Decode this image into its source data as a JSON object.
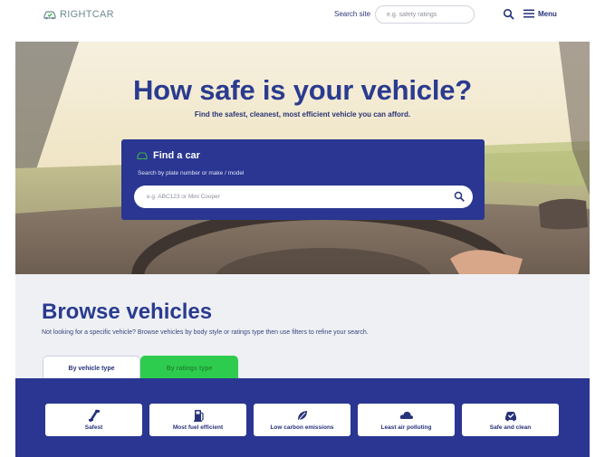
{
  "header": {
    "logo_text": "RIGHTCAR",
    "search_label": "Search site",
    "search_placeholder": "e.g. safety ratings",
    "menu_label": "Menu"
  },
  "hero": {
    "title": "How safe is your vehicle?",
    "subtitle": "Find the safest, cleanest, most efficient vehicle you can afford.",
    "find_card": {
      "title": "Find a car",
      "hint": "Search by plate number or make / model",
      "input_placeholder": "e.g. ABC123 or Mini Cooper"
    }
  },
  "browse": {
    "title": "Browse vehicles",
    "description": "Not looking for a specific vehicle? Browse vehicles by body style or ratings type then use filters to refine your search.",
    "tabs": [
      {
        "label": "By vehicle type"
      },
      {
        "label": "By ratings type"
      }
    ],
    "categories": [
      {
        "label": "Safest",
        "icon": "seatbelt-icon"
      },
      {
        "label": "Most fuel efficient",
        "icon": "fuel-pump-icon"
      },
      {
        "label": "Low carbon emissions",
        "icon": "leaf-icon"
      },
      {
        "label": "Least air polluting",
        "icon": "cloud-icon"
      },
      {
        "label": "Safe and clean",
        "icon": "car-badge-icon"
      }
    ]
  },
  "colors": {
    "brand_navy": "#2a3691",
    "title_blue": "#2a3b8f",
    "active_tab_green": "#2ecc4e",
    "section_bg": "#eef0f4"
  }
}
